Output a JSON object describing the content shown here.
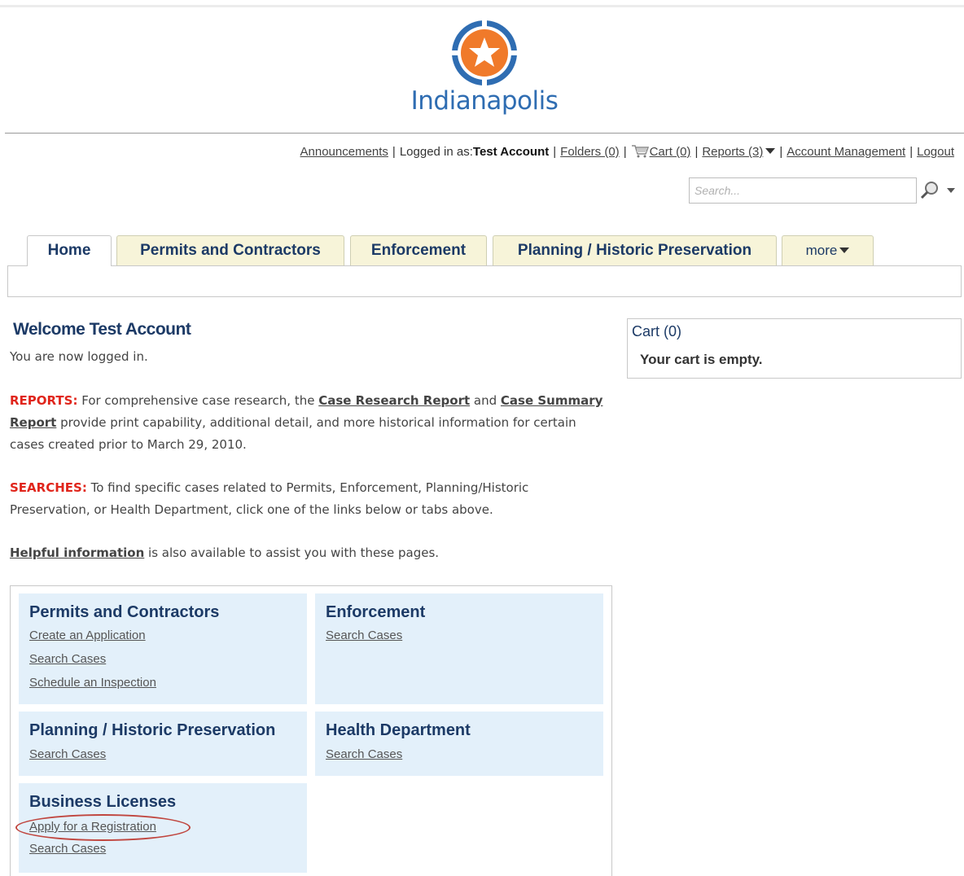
{
  "header": {
    "logo_text": "Indianapolis",
    "accent_color": "#2f6db2",
    "logo_star_color": "#f07a2a"
  },
  "utility_bar": {
    "announcements": "Announcements",
    "logged_in_label": "Logged in as:",
    "account_name": "Test Account",
    "folders": "Folders (0)",
    "cart": "Cart (0)",
    "reports": "Reports (3)",
    "account_management": "Account Management",
    "logout": "Logout"
  },
  "search": {
    "placeholder": "Search..."
  },
  "tabs": [
    {
      "label": "Home"
    },
    {
      "label": "Permits and Contractors"
    },
    {
      "label": "Enforcement"
    },
    {
      "label": "Planning / Historic Preservation"
    },
    {
      "label": "more"
    }
  ],
  "main": {
    "welcome": "Welcome Test Account",
    "logged_in_msg": "You are now logged in.",
    "reports_label": "REPORTS:",
    "reports_text_1": " For comprehensive case research, the ",
    "case_research_link": "Case Research Report",
    "reports_and": " and ",
    "case_summary_link": "Case Summary Report",
    "reports_text_2": " provide print capability, additional detail, and more historical information for certain cases created prior to March 29, 2010.",
    "searches_label": "SEARCHES:",
    "searches_text": " To find specific cases related to Permits, Enforcement, Planning/Historic Preservation, or Health Department, click one of the links below or tabs above.",
    "helpful_link": "Helpful information",
    "helpful_text": " is also available to assist you with these pages."
  },
  "cart_panel": {
    "title": "Cart (0)",
    "empty_msg": "Your cart is empty."
  },
  "cards": {
    "permits": {
      "title": "Permits and Contractors",
      "links": [
        "Create an Application",
        "Search Cases",
        "Schedule an Inspection"
      ]
    },
    "enforcement": {
      "title": "Enforcement",
      "links": [
        "Search Cases"
      ]
    },
    "planning": {
      "title": "Planning / Historic Preservation",
      "links": [
        "Search Cases"
      ]
    },
    "health": {
      "title": "Health Department",
      "links": [
        "Search Cases"
      ]
    },
    "business": {
      "title": "Business Licenses",
      "links": [
        "Apply for a Registration",
        "Search Cases"
      ]
    }
  }
}
